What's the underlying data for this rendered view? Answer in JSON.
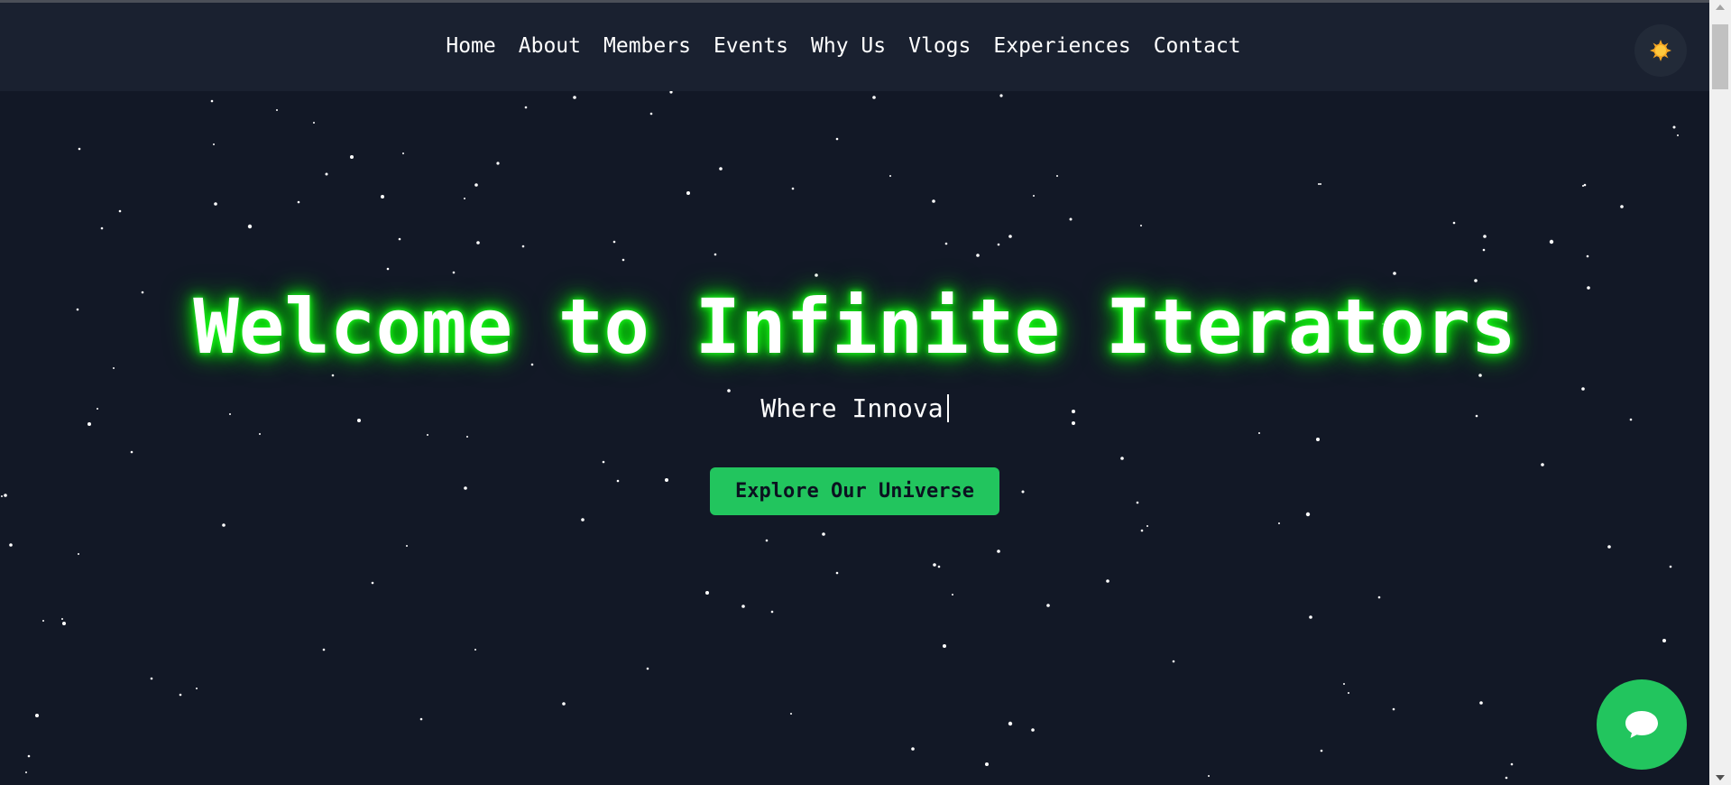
{
  "nav": {
    "items": [
      {
        "label": "Home"
      },
      {
        "label": "About"
      },
      {
        "label": "Members"
      },
      {
        "label": "Events"
      },
      {
        "label": "Why Us"
      },
      {
        "label": "Vlogs"
      },
      {
        "label": "Experiences"
      },
      {
        "label": "Contact"
      }
    ],
    "theme_toggle_icon": "sun-icon"
  },
  "hero": {
    "title": "Welcome to Infinite Iterators",
    "subtitle_typed": "Where Innova",
    "cta_label": "Explore Our Universe"
  },
  "chat": {
    "icon": "chat-bubble-icon"
  },
  "colors": {
    "background": "#121826",
    "navbar": "#1a2130",
    "accent_green": "#22c55e",
    "glow_green": "#00ff00"
  }
}
